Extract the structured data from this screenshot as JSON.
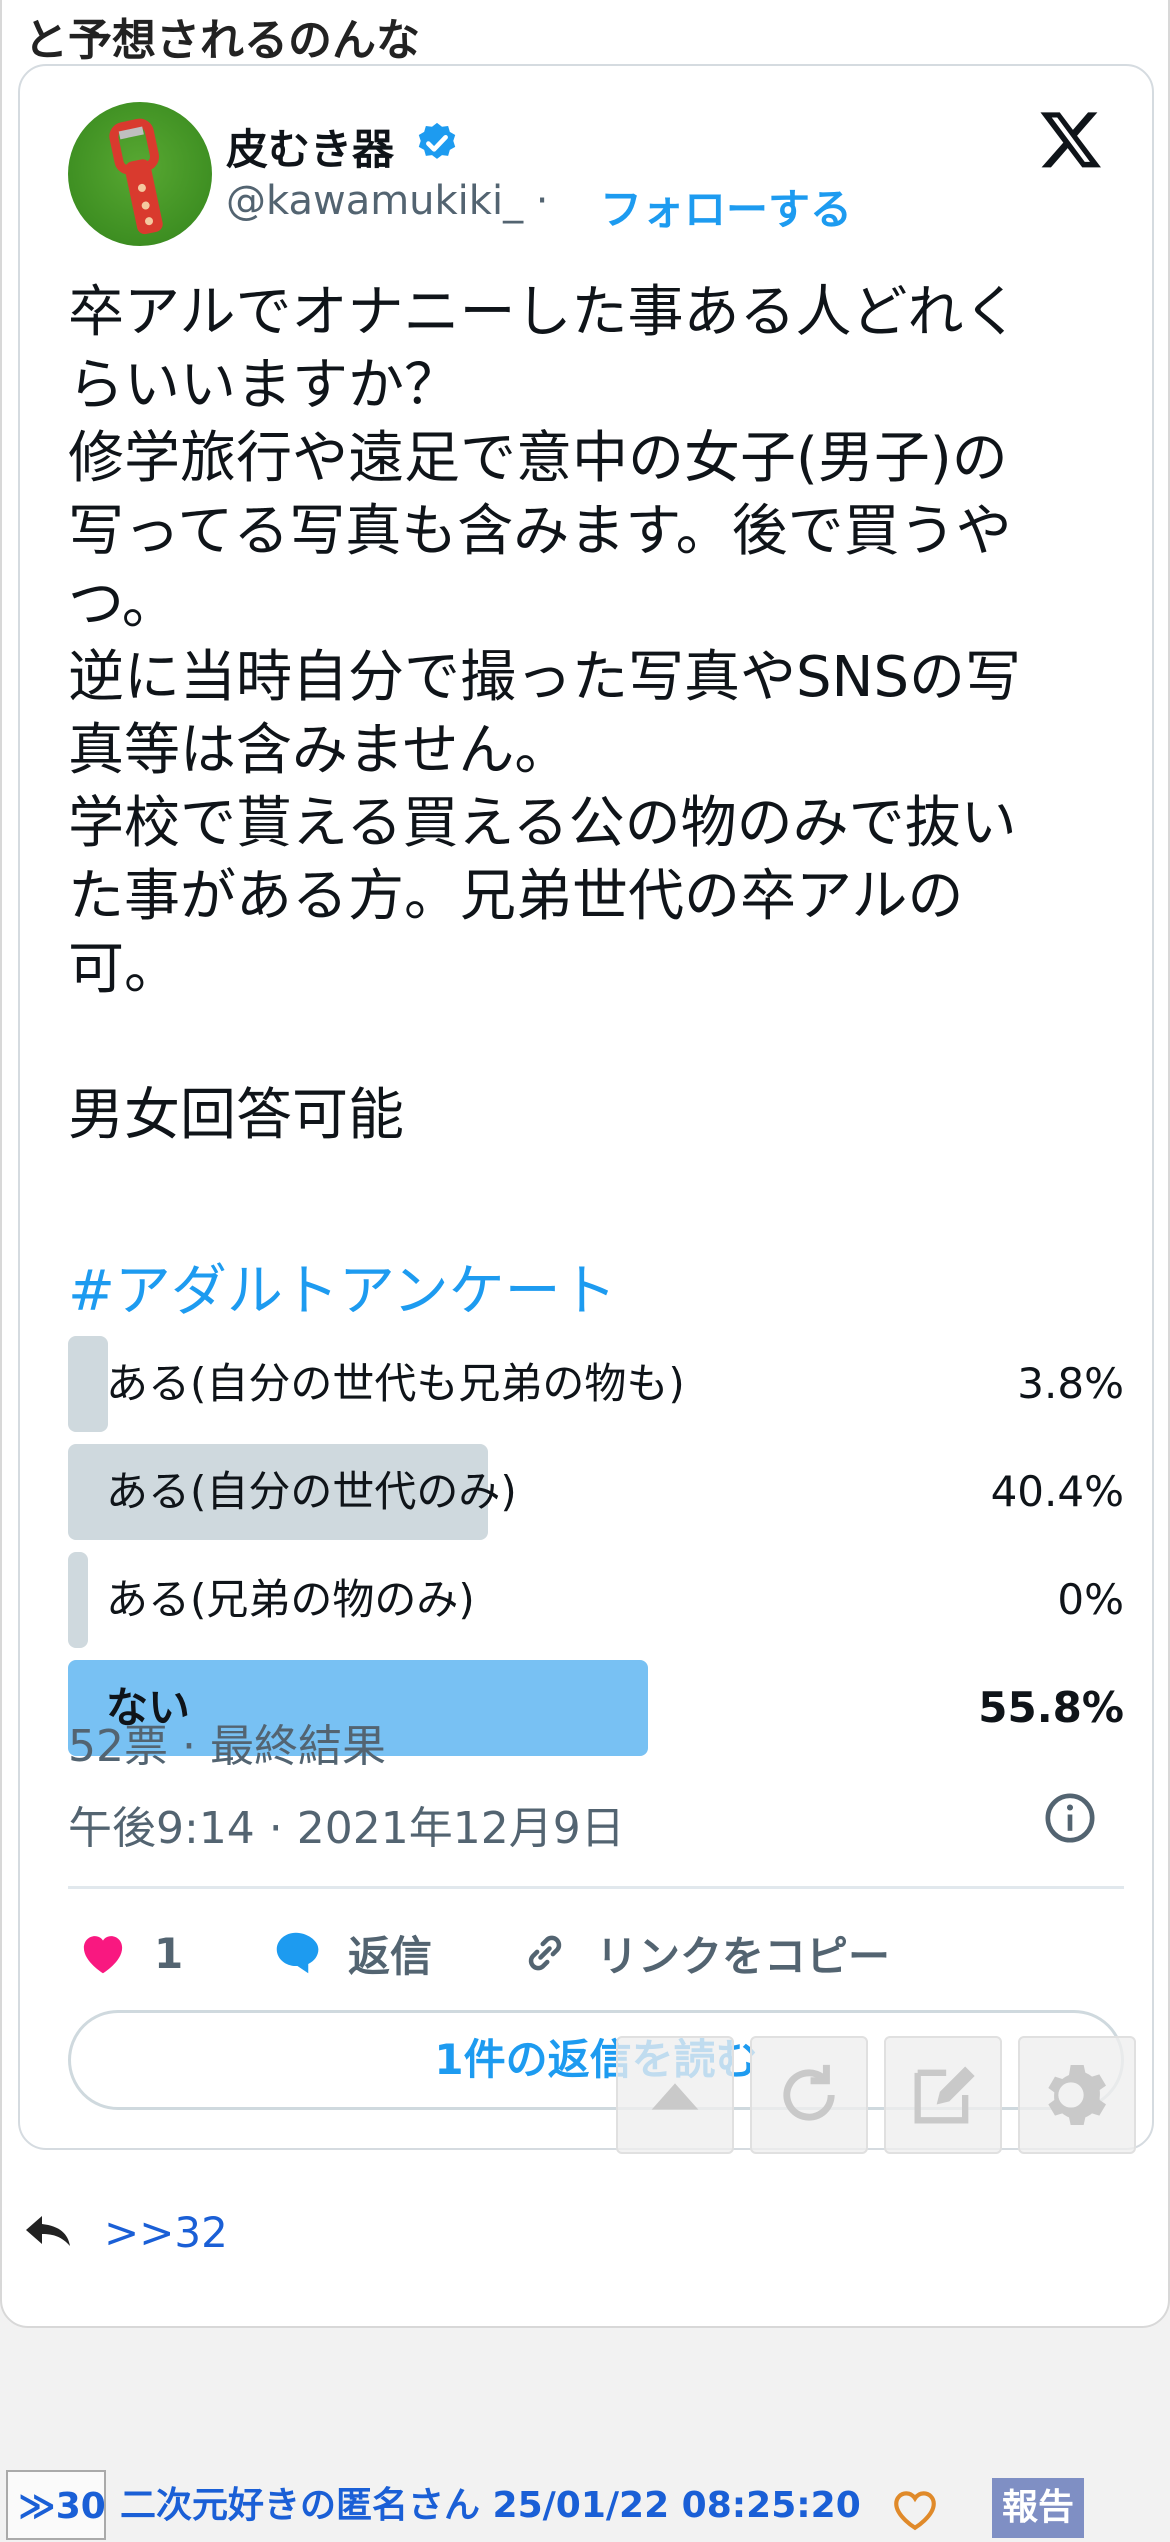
{
  "post": {
    "head_text": "と予想されるのんな",
    "reply_anchor": ">>32"
  },
  "tweet": {
    "author_name": "皮むき器",
    "handle": "@kawamukiki_ ·",
    "follow_label": "フォローする",
    "body": "卒アルでオナニーした事ある人どれく\nらいいますか？\n修学旅行や遠足で意中の女子(男子)の\n写ってる写真も含みます。後で買うや\nつ。\n逆に当時自分で撮った写真やSNSの写\n真等は含みません。\n学校で貰える買える公の物のみで抜い\nた事がある方。兄弟世代の卒アルの\n可。\n\n男女回答可能",
    "hashtag": "#アダルトアンケート",
    "poll": {
      "options": [
        {
          "label": "ある(自分の世代も兄弟の物も)",
          "percent_text": "3.8%",
          "percent": 3.8,
          "winner": false
        },
        {
          "label": "ある(自分の世代のみ)",
          "percent_text": "40.4%",
          "percent": 40.4,
          "winner": false
        },
        {
          "label": "ある(兄弟の物のみ)",
          "percent_text": "0%",
          "percent": 0,
          "winner": false
        },
        {
          "label": "ない",
          "percent_text": "55.8%",
          "percent": 55.8,
          "winner": true
        }
      ],
      "summary": "52票 · 最終結果"
    },
    "timestamp": "午後9:14 · 2021年12月9日",
    "actions": {
      "like_count": "1",
      "reply_label": "返信",
      "copy_link_label": "リンクをコピー"
    },
    "read_replies_label": "1件の返信を読む"
  },
  "next_post": {
    "number": "≫30",
    "poster": "二次元好きの匿名さん 25/01/22 08:25:20",
    "report_label": "報告"
  },
  "colors": {
    "accent": "#1d9bf0",
    "poll_bar": "#cfd9de",
    "poll_winner": "#78c1f3",
    "like": "#f91880",
    "link": "#1a5fd6"
  }
}
